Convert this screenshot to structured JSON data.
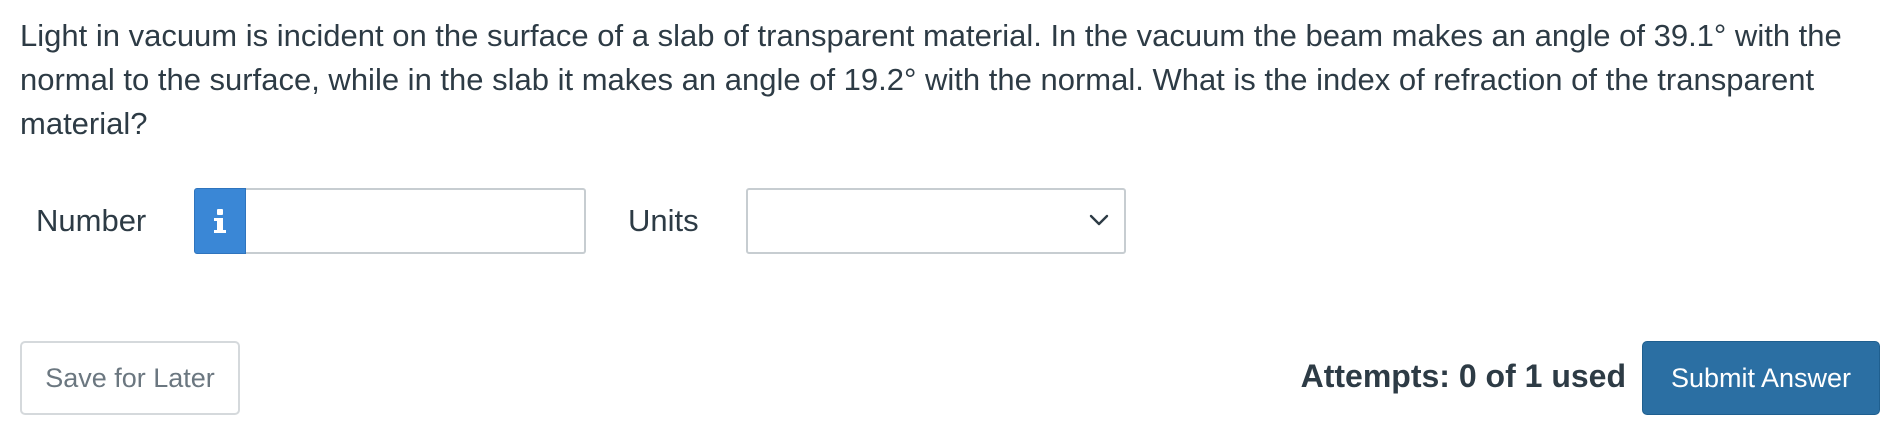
{
  "question": {
    "text": "Light in vacuum is incident on the surface of a slab of transparent material. In the vacuum the beam makes an angle of 39.1° with the normal to the surface, while in the slab it makes an angle of 19.2° with the normal. What is the index of refraction of the transparent material?"
  },
  "answer": {
    "number_label": "Number",
    "number_value": "",
    "number_placeholder": "",
    "info_icon": "info-icon",
    "units_label": "Units",
    "units_selected": "",
    "units_chevron_icon": "chevron-down-icon"
  },
  "footer": {
    "save_label": "Save for Later",
    "attempts_text": "Attempts: 0 of 1 used",
    "submit_label": "Submit Answer"
  },
  "colors": {
    "text": "#2d3b45",
    "info_button": "#3a87d6",
    "submit_button": "#2b6fa3",
    "input_border": "#c7cdd1"
  }
}
